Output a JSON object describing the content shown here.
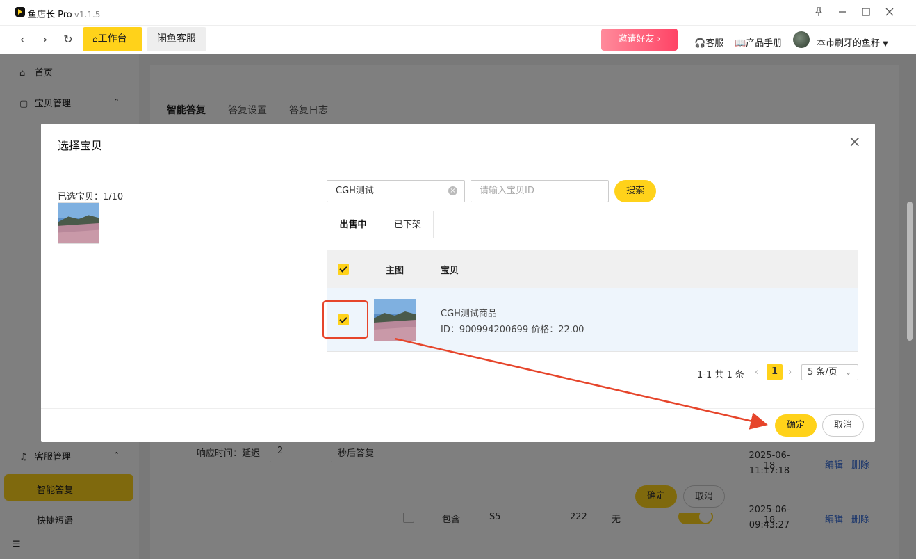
{
  "window": {
    "app_name": "鱼店长 Pro",
    "version": "v1.1.5",
    "pin_icon": "pin-icon",
    "min_icon": "minimize-icon",
    "max_icon": "maximize-icon",
    "close_icon": "close-icon"
  },
  "toolbar": {
    "back": "‹",
    "forward": "›",
    "refresh": "↻",
    "tabs": [
      "工作台",
      "闲鱼客服"
    ],
    "invite": "邀请好友",
    "service": "客服",
    "manual": "产品手册",
    "user": "本市刷牙的鱼籽"
  },
  "sidebar": {
    "items": [
      {
        "label": "首页",
        "icon": "home-icon"
      },
      {
        "label": "宝贝管理",
        "icon": "bag-icon"
      },
      {
        "label": "客服管理",
        "icon": "headset-icon"
      }
    ],
    "subs": [
      "智能答复",
      "快捷短语"
    ]
  },
  "content": {
    "tabs": [
      "智能答复",
      "答复设置",
      "答复日志"
    ]
  },
  "bg_dialog": {
    "response_label": "响应时间：延迟",
    "response_value": "2",
    "response_suffix": "秒后答复",
    "ok": "确定",
    "cancel": "取消"
  },
  "bg_table": {
    "row1": {
      "date": "2025-06-18",
      "time": "11:17:18",
      "edit": "编辑",
      "delete": "删除"
    },
    "row2": {
      "c1": "包含",
      "c2": "S5",
      "c3": "222",
      "c4": "无",
      "date": "2025-06-18",
      "time": "09:43:27",
      "edit": "编辑",
      "delete": "删除"
    }
  },
  "modal": {
    "title": "选择宝贝",
    "selected_label": "已选宝贝：1/10",
    "search_value": "CGH测试",
    "id_placeholder": "请输入宝贝ID",
    "search_btn": "搜索",
    "tabs": [
      "出售中",
      "已下架"
    ],
    "columns": [
      "主图",
      "宝贝"
    ],
    "rows": [
      {
        "name": "CGH测试商品",
        "meta": "ID：900994200699  价格：22.00",
        "checked": true
      }
    ],
    "pager": {
      "total": "1-1 共 1 条",
      "page": "1",
      "size": "5 条/页"
    },
    "ok": "确定",
    "cancel": "取消"
  },
  "colors": {
    "accent": "#ffd21a",
    "highlight": "#e6452b",
    "link": "#3a6fd8"
  }
}
